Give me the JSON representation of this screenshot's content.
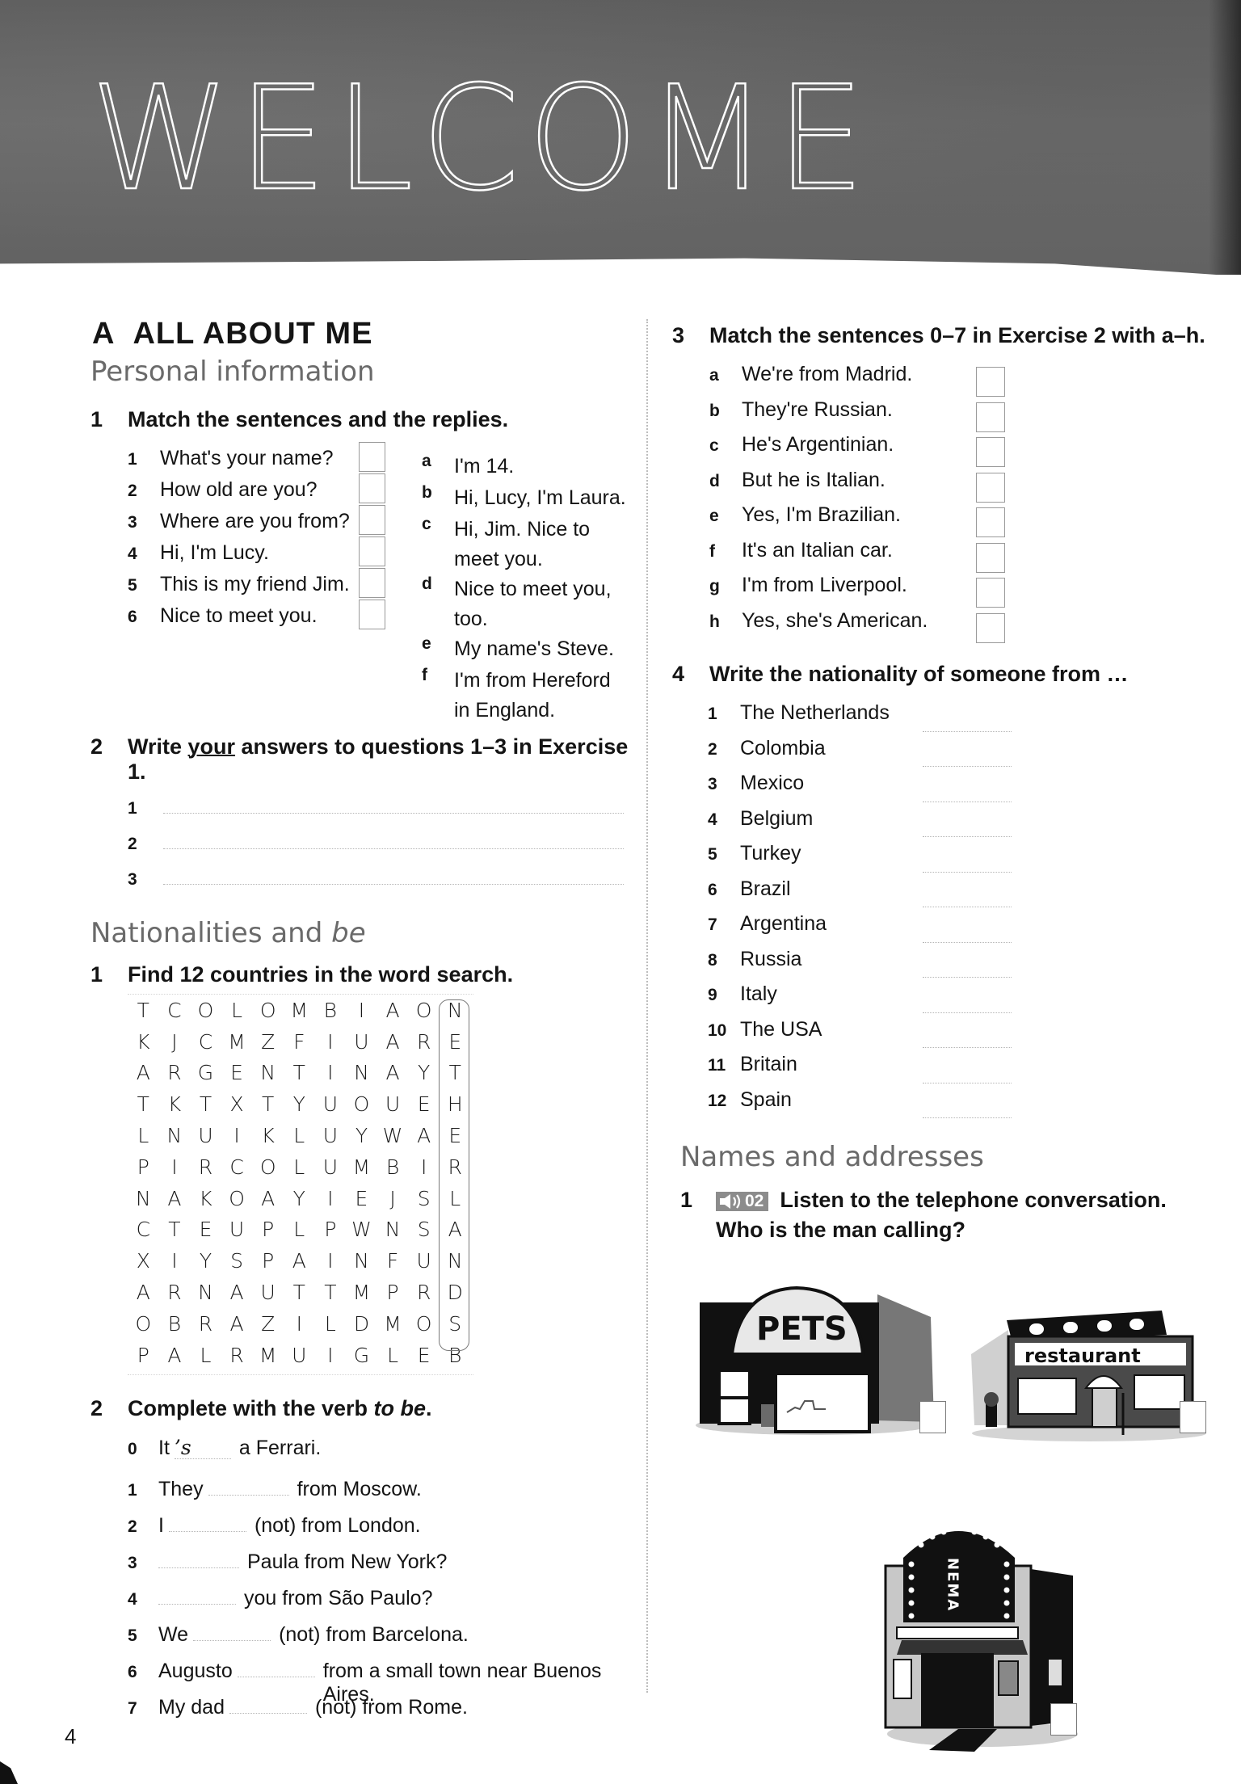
{
  "banner": {
    "title": "WELCOME"
  },
  "section": {
    "letter": "A",
    "title": "ALL ABOUT ME"
  },
  "personal_information": {
    "heading": "Personal information",
    "exercise1": {
      "number": "1",
      "instruction": "Match the sentences and the replies.",
      "sentences": [
        {
          "n": "1",
          "text": "What's your name?"
        },
        {
          "n": "2",
          "text": "How old are you?"
        },
        {
          "n": "3",
          "text": "Where are you from?"
        },
        {
          "n": "4",
          "text": "Hi, I'm Lucy."
        },
        {
          "n": "5",
          "text": "This is my friend Jim."
        },
        {
          "n": "6",
          "text": "Nice to meet you."
        }
      ],
      "replies": [
        {
          "n": "a",
          "text": "I'm 14."
        },
        {
          "n": "b",
          "text": "Hi, Lucy, I'm Laura."
        },
        {
          "n": "c",
          "text": "Hi, Jim. Nice to meet you."
        },
        {
          "n": "d",
          "text": "Nice to meet you, too."
        },
        {
          "n": "e",
          "text": "My name's Steve."
        },
        {
          "n": "f",
          "text": "I'm from Hereford in England."
        }
      ]
    },
    "exercise2": {
      "number": "2",
      "instruction_pre": "Write ",
      "instruction_emph": "your",
      "instruction_post": " answers to questions 1–3 in Exercise 1.",
      "lines": [
        "1",
        "2",
        "3"
      ]
    }
  },
  "nationalities": {
    "heading_pre": "Nationalities and ",
    "heading_emph": "be",
    "exercise1": {
      "number": "1",
      "instruction": "Find 12 countries in the word search.",
      "grid": [
        [
          "T",
          "C",
          "O",
          "L",
          "O",
          "M",
          "B",
          "I",
          "A",
          "O",
          "N"
        ],
        [
          "K",
          "J",
          "C",
          "M",
          "Z",
          "F",
          "I",
          "U",
          "A",
          "R",
          "E"
        ],
        [
          "A",
          "R",
          "G",
          "E",
          "N",
          "T",
          "I",
          "N",
          "A",
          "Y",
          "T"
        ],
        [
          "T",
          "K",
          "T",
          "X",
          "T",
          "Y",
          "U",
          "O",
          "U",
          "E",
          "H"
        ],
        [
          "L",
          "N",
          "U",
          "I",
          "K",
          "L",
          "U",
          "Y",
          "W",
          "A",
          "E"
        ],
        [
          "P",
          "I",
          "R",
          "C",
          "O",
          "L",
          "U",
          "M",
          "B",
          "I",
          "R"
        ],
        [
          "N",
          "A",
          "K",
          "O",
          "A",
          "Y",
          "I",
          "E",
          "J",
          "S",
          "L"
        ],
        [
          "C",
          "T",
          "E",
          "U",
          "P",
          "L",
          "P",
          "W",
          "N",
          "S",
          "A"
        ],
        [
          "X",
          "I",
          "Y",
          "S",
          "P",
          "A",
          "I",
          "N",
          "F",
          "U",
          "N"
        ],
        [
          "A",
          "R",
          "N",
          "A",
          "U",
          "T",
          "T",
          "M",
          "P",
          "R",
          "D"
        ],
        [
          "O",
          "B",
          "R",
          "A",
          "Z",
          "I",
          "L",
          "D",
          "M",
          "O",
          "S"
        ],
        [
          "P",
          "A",
          "L",
          "R",
          "M",
          "U",
          "I",
          "G",
          "L",
          "E",
          "B"
        ]
      ],
      "example_circled": "NETHERLANDS"
    },
    "exercise2": {
      "number": "2",
      "instruction_pre": "Complete with the verb ",
      "instruction_emph": "to be",
      "instruction_post": ".",
      "items": [
        {
          "n": "0",
          "before": "It",
          "answer": "’s",
          "after": "a Ferrari."
        },
        {
          "n": "1",
          "before": "They",
          "answer": "",
          "after": "from Moscow."
        },
        {
          "n": "2",
          "before": "I",
          "answer": "",
          "after": "(not) from London."
        },
        {
          "n": "3",
          "before": "",
          "answer": "",
          "after": "Paula from New York?"
        },
        {
          "n": "4",
          "before": "",
          "answer": "",
          "after": "you from São Paulo?"
        },
        {
          "n": "5",
          "before": "We",
          "answer": "",
          "after": "(not) from Barcelona."
        },
        {
          "n": "6",
          "before": "Augusto",
          "answer": "",
          "after": "from a small town near Buenos Aires."
        },
        {
          "n": "7",
          "before": "My dad",
          "answer": "",
          "after": "(not) from Rome."
        }
      ]
    },
    "exercise3": {
      "number": "3",
      "instruction": "Match the sentences 0–7 in Exercise 2 with a–h.",
      "items": [
        {
          "n": "a",
          "text": "We're from Madrid."
        },
        {
          "n": "b",
          "text": "They're Russian."
        },
        {
          "n": "c",
          "text": "He's Argentinian."
        },
        {
          "n": "d",
          "text": "But he is Italian."
        },
        {
          "n": "e",
          "text": "Yes, I'm Brazilian."
        },
        {
          "n": "f",
          "text": "It's an Italian car."
        },
        {
          "n": "g",
          "text": "I'm from Liverpool."
        },
        {
          "n": "h",
          "text": "Yes, she's American."
        }
      ]
    },
    "exercise4": {
      "number": "4",
      "instruction": "Write the nationality of someone from …",
      "items": [
        {
          "n": "1",
          "text": "The Netherlands"
        },
        {
          "n": "2",
          "text": "Colombia"
        },
        {
          "n": "3",
          "text": "Mexico"
        },
        {
          "n": "4",
          "text": "Belgium"
        },
        {
          "n": "5",
          "text": "Turkey"
        },
        {
          "n": "6",
          "text": "Brazil"
        },
        {
          "n": "7",
          "text": "Argentina"
        },
        {
          "n": "8",
          "text": "Russia"
        },
        {
          "n": "9",
          "text": "Italy"
        },
        {
          "n": "10",
          "text": "The USA"
        },
        {
          "n": "11",
          "text": "Britain"
        },
        {
          "n": "12",
          "text": "Spain"
        }
      ]
    }
  },
  "names_addresses": {
    "heading": "Names and addresses",
    "exercise1": {
      "number": "1",
      "audio_track": "02",
      "audio_icon": "speaker-icon",
      "instruction_line1": "Listen to the telephone conversation.",
      "instruction_line2": "Who is the man calling?"
    },
    "pictures": [
      {
        "name": "pet-shop",
        "sign": "PETS"
      },
      {
        "name": "restaurant",
        "sign": "restaurant"
      },
      {
        "name": "cinema",
        "sign": "CINEMA",
        "sign_visible": "NEMA"
      }
    ]
  },
  "footer": {
    "page_number": "4"
  }
}
